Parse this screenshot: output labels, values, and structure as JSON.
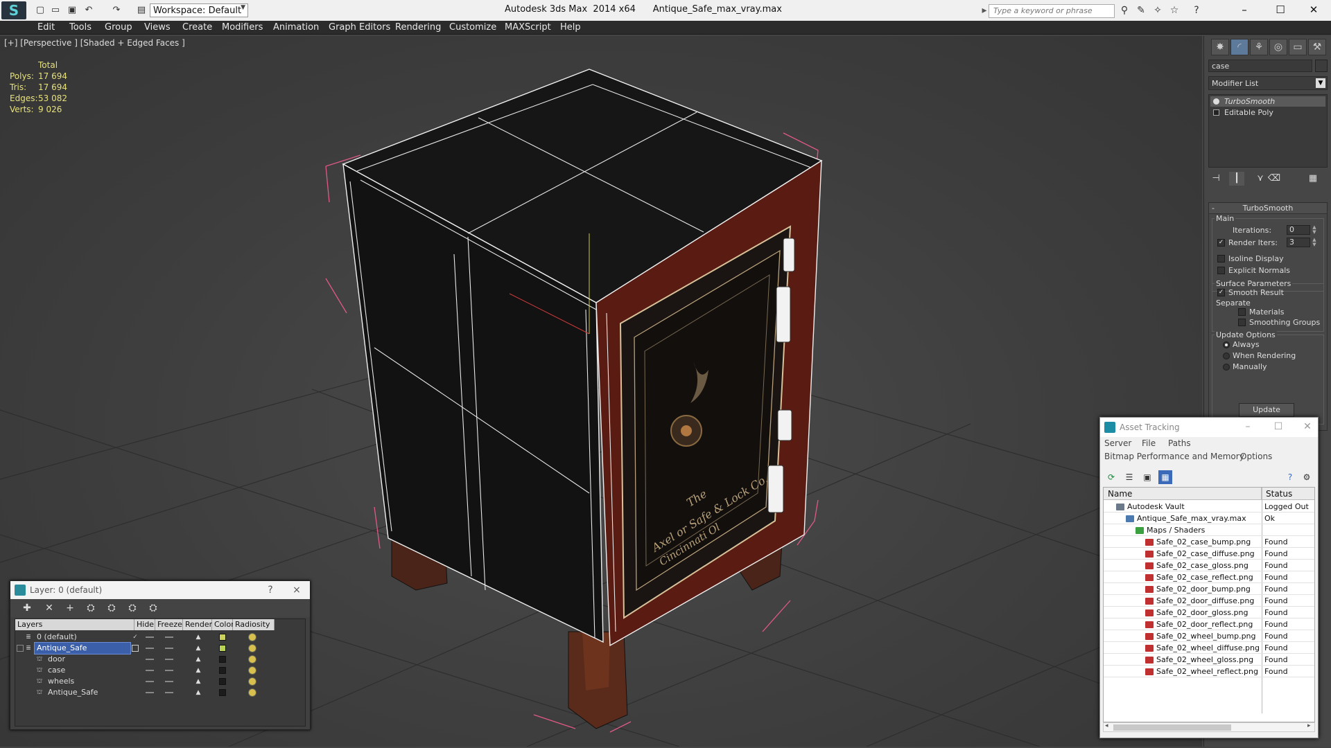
{
  "titlebar": {
    "app_title": "Autodesk 3ds Max  2014 x64",
    "file_name": "Antique_Safe_max_vray.max",
    "workspace": "Workspace: Default",
    "search_placeholder": "Type a keyword or phrase"
  },
  "menubar": [
    "Edit",
    "Tools",
    "Group",
    "Views",
    "Create",
    "Modifiers",
    "Animation",
    "Graph Editors",
    "Rendering",
    "Customize",
    "MAXScript",
    "Help"
  ],
  "viewport": {
    "label": "[+] [Perspective ] [Shaded + Edged Faces ]",
    "stats": {
      "header": "Total",
      "rows": [
        {
          "label": "Polys:",
          "value": "17 694"
        },
        {
          "label": "Tris:",
          "value": "17 694"
        },
        {
          "label": "Edges:",
          "value": "53 082"
        },
        {
          "label": "Verts:",
          "value": "9 026"
        }
      ]
    },
    "safe_label_lines": [
      "The",
      "Axel or Safe & Lock Co.",
      "Cincinnati Ol"
    ]
  },
  "command_panel": {
    "object_name": "case",
    "modifier_list": "Modifier List",
    "stack": [
      "TurboSmooth",
      "Editable Poly"
    ],
    "turbosmooth": {
      "title": "TurboSmooth",
      "main_label": "Main",
      "iterations_label": "Iterations:",
      "iterations_value": "0",
      "render_iters_label": "Render Iters:",
      "render_iters_value": "3",
      "isoline": "Isoline Display",
      "explicit_normals": "Explicit Normals",
      "surface_params": "Surface Parameters",
      "smooth_result": "Smooth Result",
      "separate": "Separate",
      "materials": "Materials",
      "smoothing_groups": "Smoothing Groups",
      "update_options": "Update Options",
      "always": "Always",
      "when_rendering": "When Rendering",
      "manually": "Manually",
      "update_button": "Update"
    }
  },
  "layer_dialog": {
    "title": "Layer: 0 (default)",
    "help": "?",
    "close": "×",
    "columns": [
      "Layers",
      "Hide",
      "Freeze",
      "Render",
      "Color",
      "Radiosity"
    ],
    "rows": [
      {
        "name": "0 (default)",
        "current": "✓",
        "color": "#c9d25a"
      },
      {
        "name": "Antique_Safe",
        "current": "",
        "color": "#b8d452"
      },
      {
        "name": "door",
        "current": "",
        "color": "#1c1c1c"
      },
      {
        "name": "case",
        "current": "",
        "color": "#1c1c1c"
      },
      {
        "name": "wheels",
        "current": "",
        "color": "#1c1c1c"
      },
      {
        "name": "Antique_Safe",
        "current": "",
        "color": "#1c1c1c"
      }
    ]
  },
  "asset_tracking": {
    "title": "Asset Tracking",
    "menu_row1": [
      "Server",
      "File",
      "Paths"
    ],
    "menu_row2": [
      "Bitmap Performance and Memory",
      "Options"
    ],
    "columns": [
      "Name",
      "Status"
    ],
    "rows": [
      {
        "name": "Autodesk Vault",
        "status": "Logged Out",
        "indent": 0,
        "kind": "vault"
      },
      {
        "name": "Antique_Safe_max_vray.max",
        "status": "Ok",
        "indent": 1,
        "kind": "max"
      },
      {
        "name": "Maps / Shaders",
        "status": "",
        "indent": 2,
        "kind": "folder"
      },
      {
        "name": "Safe_02_case_bump.png",
        "status": "Found",
        "indent": 3,
        "kind": "png"
      },
      {
        "name": "Safe_02_case_diffuse.png",
        "status": "Found",
        "indent": 3,
        "kind": "png"
      },
      {
        "name": "Safe_02_case_gloss.png",
        "status": "Found",
        "indent": 3,
        "kind": "png"
      },
      {
        "name": "Safe_02_case_reflect.png",
        "status": "Found",
        "indent": 3,
        "kind": "png"
      },
      {
        "name": "Safe_02_door_bump.png",
        "status": "Found",
        "indent": 3,
        "kind": "png"
      },
      {
        "name": "Safe_02_door_diffuse.png",
        "status": "Found",
        "indent": 3,
        "kind": "png"
      },
      {
        "name": "Safe_02_door_gloss.png",
        "status": "Found",
        "indent": 3,
        "kind": "png"
      },
      {
        "name": "Safe_02_door_reflect.png",
        "status": "Found",
        "indent": 3,
        "kind": "png"
      },
      {
        "name": "Safe_02_wheel_bump.png",
        "status": "Found",
        "indent": 3,
        "kind": "png"
      },
      {
        "name": "Safe_02_wheel_diffuse.png",
        "status": "Found",
        "indent": 3,
        "kind": "png"
      },
      {
        "name": "Safe_02_wheel_gloss.png",
        "status": "Found",
        "indent": 3,
        "kind": "png"
      },
      {
        "name": "Safe_02_wheel_reflect.png",
        "status": "Found",
        "indent": 3,
        "kind": "png"
      }
    ]
  }
}
